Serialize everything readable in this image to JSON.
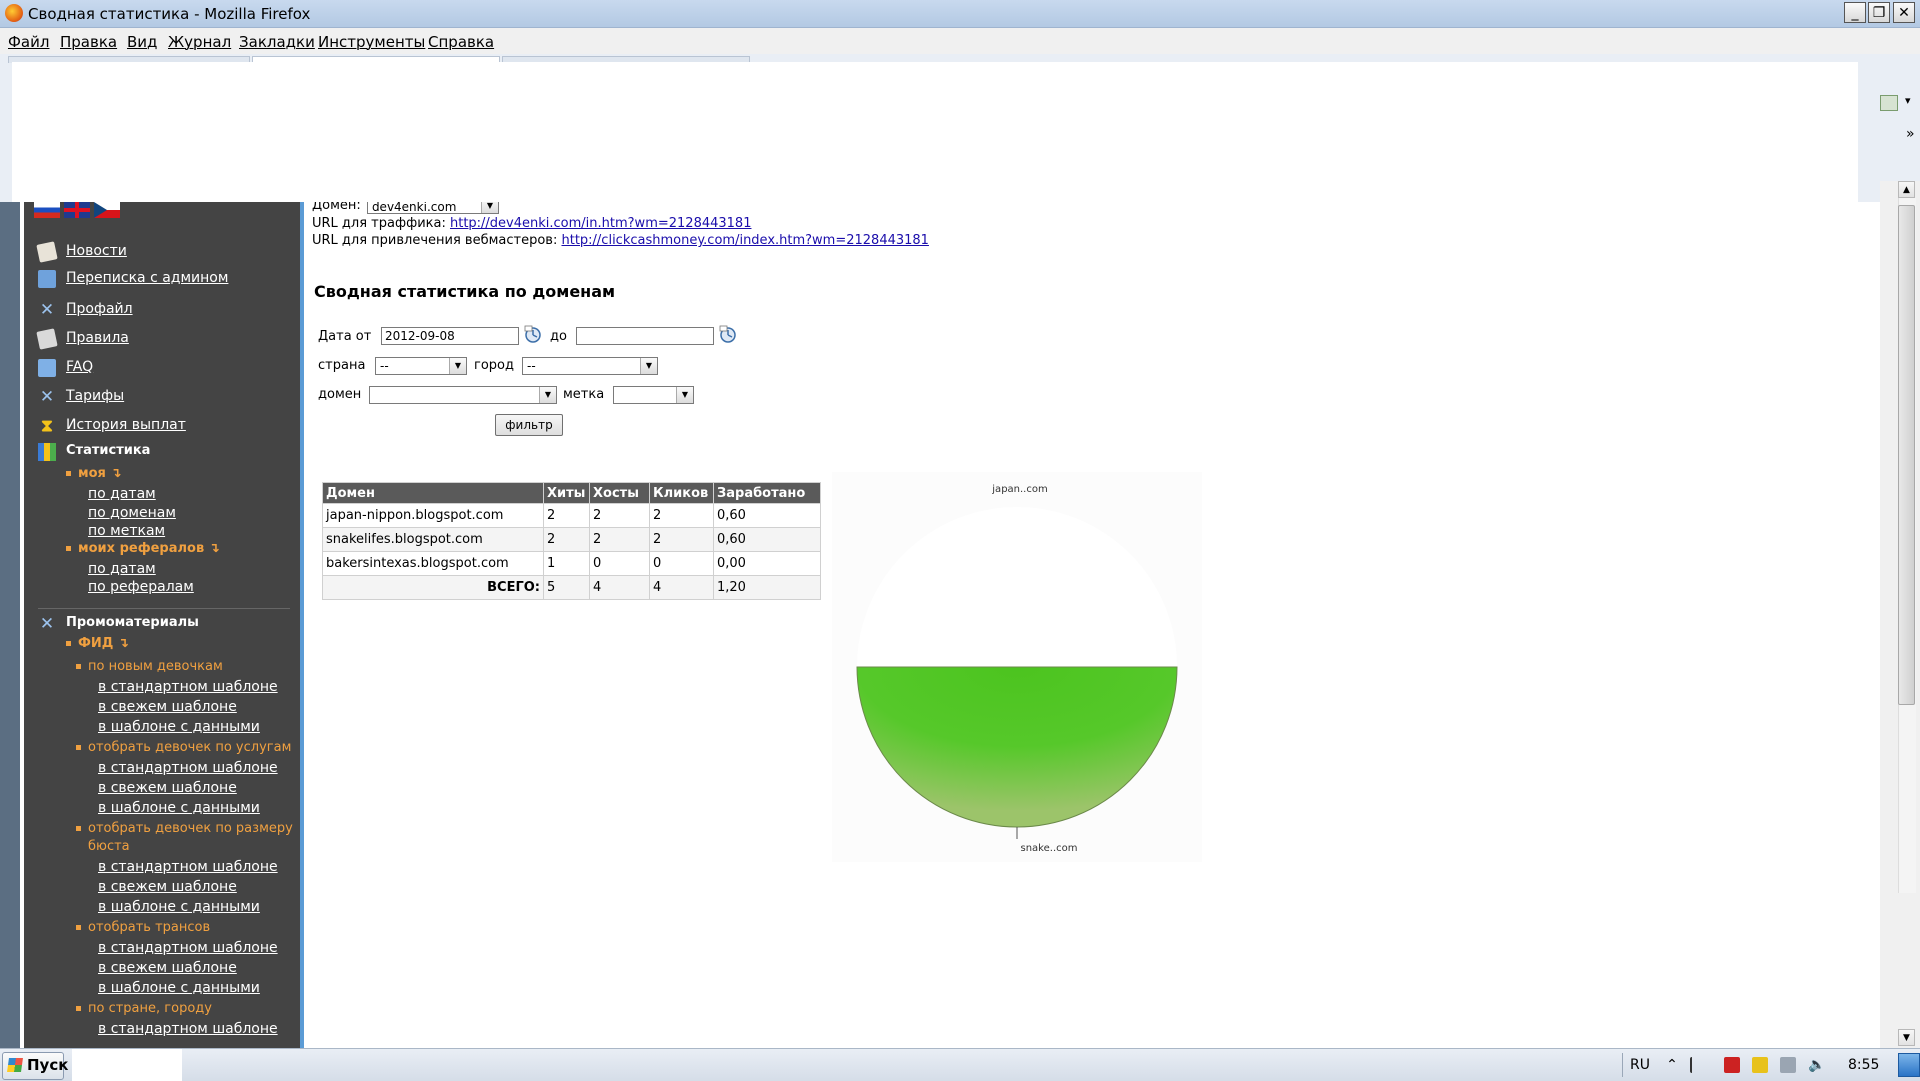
{
  "window": {
    "title": "Сводная статистика - Mozilla Firefox",
    "buttons": {
      "minimize": "_",
      "restore": "❐",
      "close": "✕"
    }
  },
  "menu": [
    "Файл",
    "Правка",
    "Вид",
    "Журнал",
    "Закладки",
    "Инструменты",
    "Справка"
  ],
  "sidebar": {
    "nav": [
      {
        "label": "Новости",
        "icon": "news-icon"
      },
      {
        "label": "Переписка с админом",
        "icon": "mail-icon"
      },
      {
        "label": "Профайл",
        "icon": "tools-icon"
      },
      {
        "label": "Правила",
        "icon": "rules-icon"
      },
      {
        "label": "FAQ",
        "icon": "faq-icon"
      },
      {
        "label": "Тарифы",
        "icon": "tools-icon"
      },
      {
        "label": "История выплат",
        "icon": "hourglass-icon"
      }
    ],
    "stats_heading": "Статистика",
    "my_label": "моя",
    "my_links": [
      "по датам",
      "по доменам",
      "по меткам"
    ],
    "ref_label": "моих рефералов",
    "ref_links": [
      "по датам",
      "по рефералам"
    ],
    "promo_heading": "Промоматериалы",
    "feed_label": "ФИД",
    "promo_groups": [
      {
        "label": "по новым девочкам",
        "links": [
          "в стандартном шаблоне",
          "в свежем шаблоне",
          "в шаблоне с данными"
        ]
      },
      {
        "label": "отобрать девочек по услугам",
        "links": [
          "в стандартном шаблоне",
          "в свежем шаблоне",
          "в шаблоне с данными"
        ]
      },
      {
        "label": "отобрать девочек по размеру",
        "label2": "бюста",
        "links": [
          "в стандартном шаблоне",
          "в свежем шаблоне",
          "в шаблоне с данными"
        ]
      },
      {
        "label": "отобрать трансов",
        "links": [
          "в стандартном шаблоне",
          "в свежем шаблоне",
          "в шаблоне с данными"
        ]
      },
      {
        "label": "по стране, городу",
        "links": [
          "в стандартном шаблоне"
        ]
      }
    ]
  },
  "main": {
    "domain_label": "Домен:",
    "domain_value": "dev4enki.com",
    "traffic_label": "URL для траффика:",
    "traffic_url": "http://dev4enki.com/in.htm?wm=2128443181",
    "wm_label": "URL для привлечения вебмастеров:",
    "wm_url": "http://clickcashmoney.com/index.htm?wm=2128443181",
    "heading": "Сводная статистика по доменам",
    "filter": {
      "date_from_label": "Дата от",
      "date_from_value": "2012-09-08",
      "date_to_label": "до",
      "date_to_value": "",
      "country_label": "страна",
      "country_value": "--",
      "city_label": "город",
      "city_value": "--",
      "domain_label": "домен",
      "domain_value": "",
      "tag_label": "метка",
      "tag_value": "",
      "submit_label": "фильтр"
    },
    "table": {
      "headers": [
        "Домен",
        "Хиты",
        "Хосты",
        "Кликов",
        "Заработано"
      ],
      "rows": [
        [
          "japan-nippon.blogspot.com",
          "2",
          "2",
          "2",
          "0,60"
        ],
        [
          "snakelifes.blogspot.com",
          "2",
          "2",
          "2",
          "0,60"
        ],
        [
          "bakersintexas.blogspot.com",
          "1",
          "0",
          "0",
          "0,00"
        ]
      ],
      "total": [
        "ВСЕГО:",
        "5",
        "4",
        "4",
        "1,20"
      ]
    }
  },
  "chart_data": {
    "type": "pie",
    "slices": [
      {
        "label": "japan..com",
        "value": 2,
        "color": "#ffffff"
      },
      {
        "label": "snake..com",
        "value": 2,
        "color": "#4cc41f"
      }
    ]
  },
  "taskbar": {
    "start_label": "Пуск",
    "lang": "RU",
    "clock": "8:55"
  }
}
